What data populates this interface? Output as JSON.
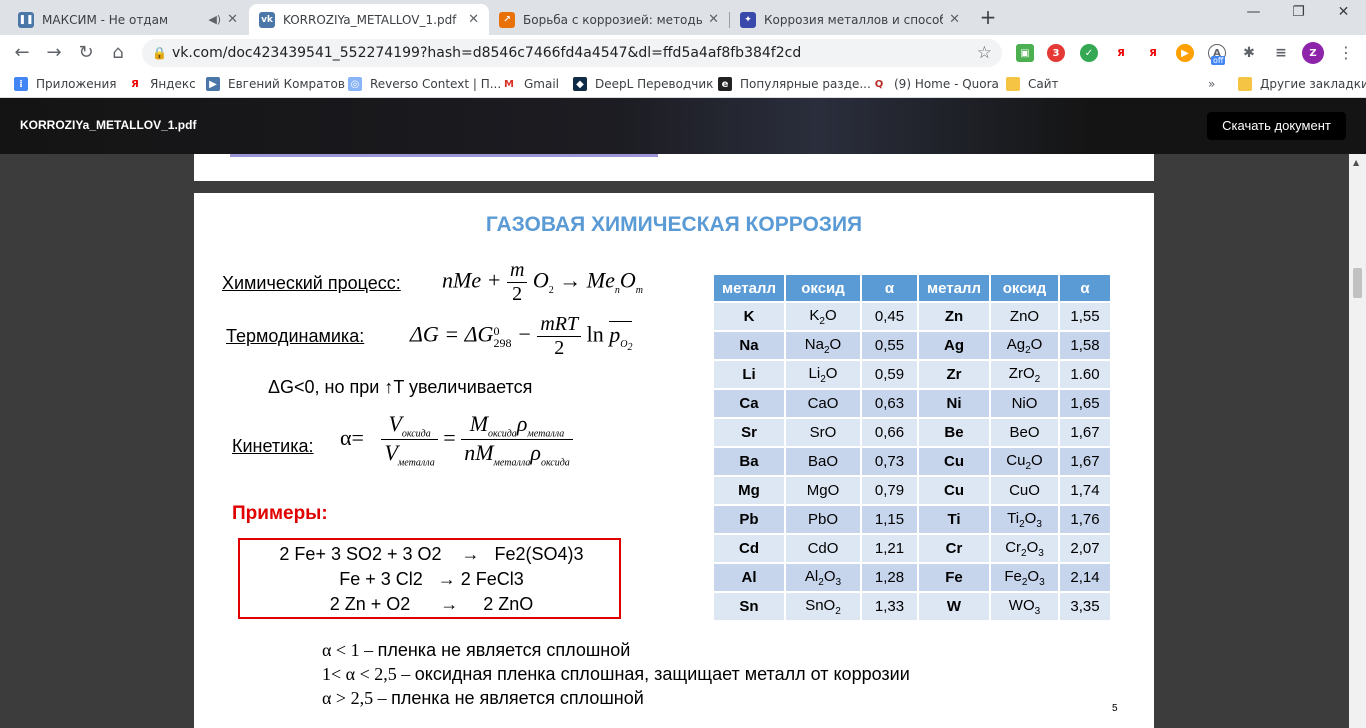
{
  "browser": {
    "tabs": [
      {
        "title": "МАКСИМ - Не отдам",
        "favicon": "pause-icon",
        "color": "#4a76a8"
      },
      {
        "title": "KORROZIYa_METALLOV_1.pdf",
        "favicon": "vk-icon",
        "color": "#4a76a8"
      },
      {
        "title": "Борьба с коррозией: методы за",
        "favicon": "arrow-icon",
        "color": "#e8710a"
      },
      {
        "title": "Коррозия металлов и способы",
        "favicon": "site-icon",
        "color": "#3949ab"
      }
    ],
    "url": "vk.com/doc423439541_552274199?hash=d8546c7466fd4a4547&dl=ffd5a4af8fb384f2cd",
    "bookmarks": [
      {
        "label": "Приложения",
        "icon": "apps-icon",
        "color": "#4285f4"
      },
      {
        "label": "Яндекс",
        "icon": "yandex-icon",
        "color": "#e00"
      },
      {
        "label": "Евгений Комратов",
        "icon": "play-icon",
        "color": "#4a76a8"
      },
      {
        "label": "Reverso Context | П...",
        "icon": "reverso-icon",
        "color": "#8ab4f8"
      },
      {
        "label": "Gmail",
        "icon": "gmail-icon",
        "color": "#d93025"
      },
      {
        "label": "DeepL Переводчик",
        "icon": "deepl-icon",
        "color": "#0f2b46"
      },
      {
        "label": "Популярные разде...",
        "icon": "e-icon",
        "color": "#222"
      },
      {
        "label": "(9) Home - Quora",
        "icon": "quora-icon",
        "color": "#b92b27"
      },
      {
        "label": "Сайт",
        "icon": "folder-icon",
        "color": "#f6c445"
      }
    ],
    "other_bookmarks": "Другие закладки",
    "ext_badge": "3",
    "ext_off": "off",
    "profile": "Z"
  },
  "viewer": {
    "filename": "KORROZIYa_METALLOV_1.pdf",
    "download": "Скачать документ"
  },
  "slide": {
    "title": "ГАЗОВАЯ ХИМИЧЕСКАЯ КОРРОЗИЯ",
    "chem_label": "Химический процесс:",
    "thermo_label": "Термодинамика:",
    "delta_note": "ΔG<0, но при ↑T увеличивается",
    "kinetics_label": "Кинетика:",
    "examples_heading": "Примеры:",
    "examples": [
      "2 Fe+ 3 SO2 + 3 O2    →   Fe2(SO4)3",
      "Fe + 3 Cl2   → 2 FeCl3",
      "2 Zn + O2      →     2 ZnO"
    ],
    "conditions": [
      {
        "expr": "α < 1 – ",
        "text": "пленка не является сплошной"
      },
      {
        "expr": "1< α < 2,5 – ",
        "text": "оксидная пленка сплошная, защищает металл от коррозии"
      },
      {
        "expr": "α > 2,5 – ",
        "text": "пленка не является сплошной"
      }
    ],
    "page_number": "5"
  },
  "table": {
    "headers": [
      "металл",
      "оксид",
      "α",
      "металл",
      "оксид",
      "α"
    ],
    "rows": [
      [
        "K",
        "K<sub>2</sub>O",
        "0,45",
        "Zn",
        "ZnO",
        "1,55"
      ],
      [
        "Na",
        "Na<sub>2</sub>O",
        "0,55",
        "Ag",
        "Ag<sub>2</sub>O",
        "1,58"
      ],
      [
        "Li",
        "Li<sub>2</sub>O",
        "0,59",
        "Zr",
        "ZrO<sub>2</sub>",
        "1.60"
      ],
      [
        "Ca",
        "CaO",
        "0,63",
        "Ni",
        "NiO",
        "1,65"
      ],
      [
        "Sr",
        "SrO",
        "0,66",
        "Be",
        "BeO",
        "1,67"
      ],
      [
        "Ba",
        "BaO",
        "0,73",
        "Cu",
        "Cu<sub>2</sub>O",
        "1,67"
      ],
      [
        "Mg",
        "MgO",
        "0,79",
        "Cu",
        "CuO",
        "1,74"
      ],
      [
        "Pb",
        "PbO",
        "1,15",
        "Ti",
        "Ti<sub>2</sub>O<sub>3</sub>",
        "1,76"
      ],
      [
        "Cd",
        "CdO",
        "1,21",
        "Cr",
        "Cr<sub>2</sub>O<sub>3</sub>",
        "2,07"
      ],
      [
        "Al",
        "Al<sub>2</sub>O<sub>3</sub>",
        "1,28",
        "Fe",
        "Fe<sub>2</sub>O<sub>3</sub>",
        "2,14"
      ],
      [
        "Sn",
        "SnO<sub>2</sub>",
        "1,33",
        "W",
        "WO<sub>3</sub>",
        "3,35"
      ]
    ]
  },
  "colors": {
    "title_blue": "#5b9bd5",
    "header_blue": "#5b9bd5",
    "row": "#dde6f3",
    "row_alt": "#c6d5ec",
    "example_red": "#e00000"
  }
}
